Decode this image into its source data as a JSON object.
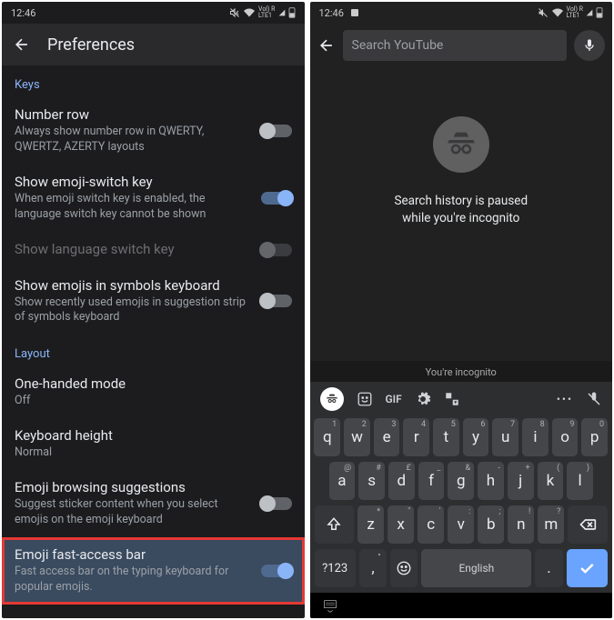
{
  "status": {
    "time": "12:46",
    "icons": "VoLTE · LTE1"
  },
  "left": {
    "title": "Preferences",
    "sections": {
      "keys": "Keys",
      "layout": "Layout"
    },
    "rows": {
      "number_row": {
        "label": "Number row",
        "sub": "Always show number row in QWERTY, QWERTZ, AZERTY layouts"
      },
      "emoji_switch": {
        "label": "Show emoji-switch key",
        "sub": "When emoji switch key is enabled, the language switch key cannot be shown"
      },
      "lang_switch": {
        "label": "Show language switch key"
      },
      "emoji_symbols": {
        "label": "Show emojis in symbols keyboard",
        "sub": "Show recently used emojis in suggestion strip of symbols keyboard"
      },
      "one_hand": {
        "label": "One-handed mode",
        "sub": "Off"
      },
      "height": {
        "label": "Keyboard height",
        "sub": "Normal"
      },
      "browse": {
        "label": "Emoji browsing suggestions",
        "sub": "Suggest sticker content when you select emojis on the emoji keyboard"
      },
      "fast": {
        "label": "Emoji fast-access bar",
        "sub": "Fast access bar on the typing keyboard for popular emojis."
      }
    }
  },
  "right": {
    "search_placeholder": "Search YouTube",
    "paused1": "Search history is paused",
    "paused2": "while you're incognito",
    "footer": "You're incognito"
  },
  "kbd": {
    "gif": "GIF",
    "space": "English",
    "sym": "?123",
    "r1": {
      "k": [
        "q",
        "w",
        "e",
        "r",
        "t",
        "y",
        "u",
        "i",
        "o",
        "p"
      ],
      "s": [
        "1",
        "2",
        "3",
        "4",
        "5",
        "6",
        "7",
        "8",
        "9",
        "0"
      ]
    },
    "r2": {
      "k": [
        "a",
        "s",
        "d",
        "f",
        "g",
        "h",
        "j",
        "k",
        "l"
      ],
      "s": [
        "@",
        "#",
        "£",
        "_",
        "&",
        "-",
        "+",
        "(",
        ")"
      ]
    },
    "r3": {
      "k": [
        "z",
        "x",
        "c",
        "v",
        "b",
        "n",
        "m"
      ],
      "s": [
        "*",
        "\"",
        "'",
        ":",
        ";",
        "!",
        "?"
      ]
    },
    "comma": ",",
    "dot": "."
  }
}
